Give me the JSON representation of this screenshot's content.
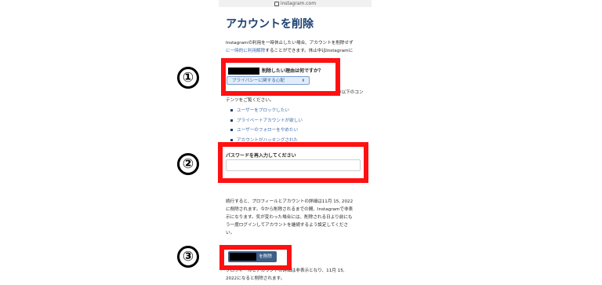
{
  "browser": {
    "url": "instagram.com"
  },
  "page": {
    "title": "アカウントを削除",
    "intro_line1": "Instagramの利用を一時休止したい場合、アカウントを削除せず",
    "intro_line2_link": "に一時的に利用解除",
    "intro_line2_rest": "することができます。休止中はInstagramに",
    "reason_label": "削除したい理由は何ですか？",
    "reason_select_value": "プライバシーに関する心配",
    "context_line1": "の以下のコン",
    "context_line2": "テンツをご覧ください。",
    "links": [
      "ユーザーをブロックしたい",
      "プライベートアカウントが欲しい",
      "ユーザーのフォローをやめたい",
      "アカウントがハッキングされた"
    ],
    "password_label": "パスワードを再入力してください",
    "notice_line1": "続行すると、プロフィールとアカウントの詳細は11月 15, 2022",
    "notice_line2": "に削除されます。今から削除されるまでの間、Instagramで非表",
    "notice_line3": "示になります。気が変わった場合には、削除される日より前にも",
    "notice_line4": "う一度ログインしてアカウントを継続するよう設定してくださ",
    "notice_line5": "い。",
    "delete_button_label": "を削除",
    "footer_line1": "プロフィールとアカウントの詳細は非表示となり、11月 15,",
    "footer_line2": "2022になると削除されます。"
  },
  "annotations": {
    "step1": "①",
    "step2": "②",
    "step3": "③",
    "highlight_color": "#ff1111"
  }
}
